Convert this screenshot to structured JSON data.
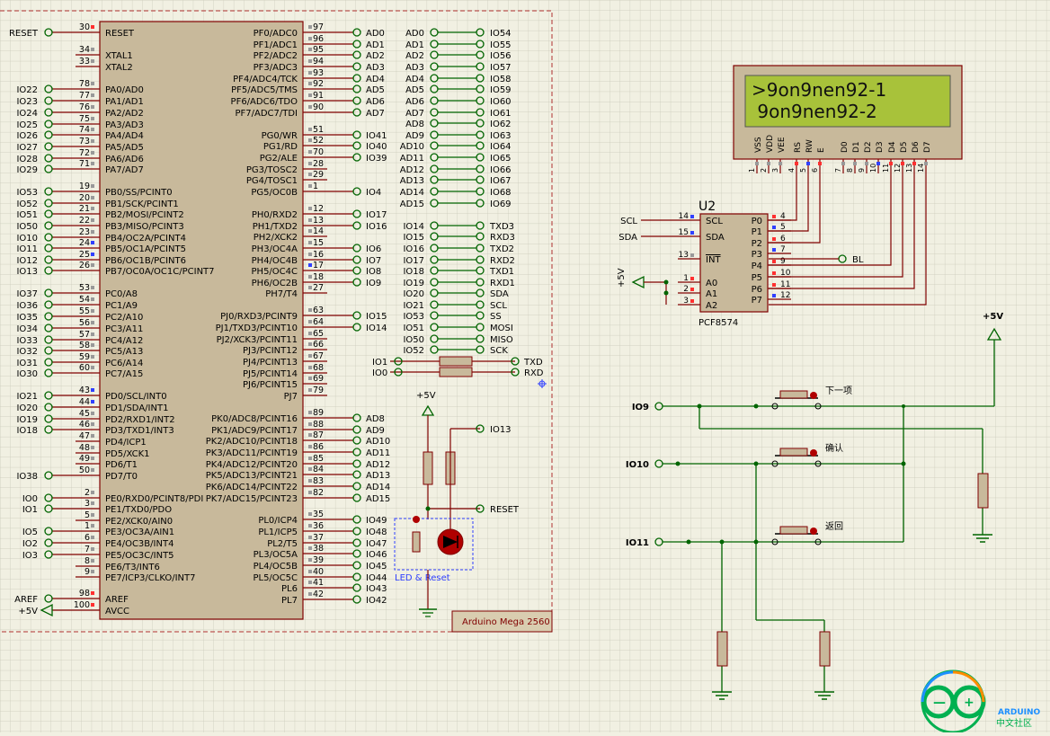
{
  "mega": {
    "title": "Arduino Mega 2560",
    "left": [
      {
        "pin": "30",
        "label": "RESET",
        "net": "RESET"
      },
      {
        "pin": "34",
        "label": "XTAL1",
        "net": ""
      },
      {
        "pin": "33",
        "label": "XTAL2",
        "net": ""
      },
      {
        "pin": "78",
        "label": "PA0/AD0",
        "net": "IO22"
      },
      {
        "pin": "77",
        "label": "PA1/AD1",
        "net": "IO23"
      },
      {
        "pin": "76",
        "label": "PA2/AD2",
        "net": "IO24"
      },
      {
        "pin": "75",
        "label": "PA3/AD3",
        "net": "IO25"
      },
      {
        "pin": "74",
        "label": "PA4/AD4",
        "net": "IO26"
      },
      {
        "pin": "73",
        "label": "PA5/AD5",
        "net": "IO27"
      },
      {
        "pin": "72",
        "label": "PA6/AD6",
        "net": "IO28"
      },
      {
        "pin": "71",
        "label": "PA7/AD7",
        "net": "IO29"
      },
      {
        "pin": "19",
        "label": "PB0/SS/PCINT0",
        "net": "IO53"
      },
      {
        "pin": "20",
        "label": "PB1/SCK/PCINT1",
        "net": "IO52"
      },
      {
        "pin": "21",
        "label": "PB2/MOSI/PCINT2",
        "net": "IO51"
      },
      {
        "pin": "22",
        "label": "PB3/MISO/PCINT3",
        "net": "IO50"
      },
      {
        "pin": "23",
        "label": "PB4/OC2A/PCINT4",
        "net": "IO10"
      },
      {
        "pin": "24",
        "label": "PB5/OC1A/PCINT5",
        "net": "IO11"
      },
      {
        "pin": "25",
        "label": "PB6/OC1B/PCINT6",
        "net": "IO12"
      },
      {
        "pin": "26",
        "label": "PB7/OC0A/OC1C/PCINT7",
        "net": "IO13"
      },
      {
        "pin": "53",
        "label": "PC0/A8",
        "net": "IO37"
      },
      {
        "pin": "54",
        "label": "PC1/A9",
        "net": "IO36"
      },
      {
        "pin": "55",
        "label": "PC2/A10",
        "net": "IO35"
      },
      {
        "pin": "56",
        "label": "PC3/A11",
        "net": "IO34"
      },
      {
        "pin": "57",
        "label": "PC4/A12",
        "net": "IO33"
      },
      {
        "pin": "58",
        "label": "PC5/A13",
        "net": "IO32"
      },
      {
        "pin": "59",
        "label": "PC6/A14",
        "net": "IO31"
      },
      {
        "pin": "60",
        "label": "PC7/A15",
        "net": "IO30"
      },
      {
        "pin": "43",
        "label": "PD0/SCL/INT0",
        "net": "IO21"
      },
      {
        "pin": "44",
        "label": "PD1/SDA/INT1",
        "net": "IO20"
      },
      {
        "pin": "45",
        "label": "PD2/RXD1/INT2",
        "net": "IO19"
      },
      {
        "pin": "46",
        "label": "PD3/TXD1/INT3",
        "net": "IO18"
      },
      {
        "pin": "47",
        "label": "PD4/ICP1",
        "net": ""
      },
      {
        "pin": "48",
        "label": "PD5/XCK1",
        "net": ""
      },
      {
        "pin": "49",
        "label": "PD6/T1",
        "net": ""
      },
      {
        "pin": "50",
        "label": "PD7/T0",
        "net": "IO38"
      },
      {
        "pin": "2",
        "label": "PE0/RXD0/PCINT8/PDI",
        "net": "IO0"
      },
      {
        "pin": "3",
        "label": "PE1/TXD0/PDO",
        "net": "IO1"
      },
      {
        "pin": "5",
        "label": "PE2/XCK0/AIN0",
        "net": ""
      },
      {
        "pin": "1",
        "label": "PE3/OC3A/AIN1",
        "net": "IO5"
      },
      {
        "pin": "6",
        "label": "PE4/OC3B/INT4",
        "net": "IO2"
      },
      {
        "pin": "7",
        "label": "PE5/OC3C/INT5",
        "net": "IO3"
      },
      {
        "pin": "8",
        "label": "PE6/T3/INT6",
        "net": ""
      },
      {
        "pin": "9",
        "label": "PE7/ICP3/CLKO/INT7",
        "net": ""
      },
      {
        "pin": "98",
        "label": "AREF",
        "net": "AREF"
      },
      {
        "pin": "100",
        "label": "AVCC",
        "net": "+5V"
      }
    ],
    "right": [
      {
        "pin": "97",
        "label": "PF0/ADC0",
        "net": "AD0"
      },
      {
        "pin": "96",
        "label": "PF1/ADC1",
        "net": "AD1"
      },
      {
        "pin": "95",
        "label": "PF2/ADC2",
        "net": "AD2"
      },
      {
        "pin": "94",
        "label": "PF3/ADC3",
        "net": "AD3"
      },
      {
        "pin": "93",
        "label": "PF4/ADC4/TCK",
        "net": "AD4"
      },
      {
        "pin": "92",
        "label": "PF5/ADC5/TMS",
        "net": "AD5"
      },
      {
        "pin": "91",
        "label": "PF6/ADC6/TDO",
        "net": "AD6"
      },
      {
        "pin": "90",
        "label": "PF7/ADC7/TDI",
        "net": "AD7"
      },
      {
        "pin": "51",
        "label": "PG0/WR",
        "net": "IO41"
      },
      {
        "pin": "52",
        "label": "PG1/RD",
        "net": "IO40"
      },
      {
        "pin": "70",
        "label": "PG2/ALE",
        "net": "IO39"
      },
      {
        "pin": "28",
        "label": "PG3/TOSC2",
        "net": ""
      },
      {
        "pin": "29",
        "label": "PG4/TOSC1",
        "net": ""
      },
      {
        "pin": "1",
        "label": "PG5/OC0B",
        "net": "IO4"
      },
      {
        "pin": "12",
        "label": "PH0/RXD2",
        "net": "IO17"
      },
      {
        "pin": "13",
        "label": "PH1/TXD2",
        "net": "IO16"
      },
      {
        "pin": "14",
        "label": "PH2/XCK2",
        "net": ""
      },
      {
        "pin": "15",
        "label": "PH3/OC4A",
        "net": "IO6"
      },
      {
        "pin": "16",
        "label": "PH4/OC4B",
        "net": "IO7"
      },
      {
        "pin": "17",
        "label": "PH5/OC4C",
        "net": "IO8"
      },
      {
        "pin": "18",
        "label": "PH6/OC2B",
        "net": "IO9"
      },
      {
        "pin": "27",
        "label": "PH7/T4",
        "net": ""
      },
      {
        "pin": "63",
        "label": "PJ0/RXD3/PCINT9",
        "net": "IO15"
      },
      {
        "pin": "64",
        "label": "PJ1/TXD3/PCINT10",
        "net": "IO14"
      },
      {
        "pin": "65",
        "label": "PJ2/XCK3/PCINT11",
        "net": ""
      },
      {
        "pin": "66",
        "label": "PJ3/PCINT12",
        "net": ""
      },
      {
        "pin": "67",
        "label": "PJ4/PCINT13",
        "net": ""
      },
      {
        "pin": "68",
        "label": "PJ5/PCINT14",
        "net": ""
      },
      {
        "pin": "69",
        "label": "PJ6/PCINT15",
        "net": ""
      },
      {
        "pin": "79",
        "label": "PJ7",
        "net": ""
      },
      {
        "pin": "89",
        "label": "PK0/ADC8/PCINT16",
        "net": "AD8"
      },
      {
        "pin": "88",
        "label": "PK1/ADC9/PCINT17",
        "net": "AD9"
      },
      {
        "pin": "87",
        "label": "PK2/ADC10/PCINT18",
        "net": "AD10"
      },
      {
        "pin": "86",
        "label": "PK3/ADC11/PCINT19",
        "net": "AD11"
      },
      {
        "pin": "85",
        "label": "PK4/ADC12/PCINT20",
        "net": "AD12"
      },
      {
        "pin": "84",
        "label": "PK5/ADC13/PCINT21",
        "net": "AD13"
      },
      {
        "pin": "83",
        "label": "PK6/ADC14/PCINT22",
        "net": "AD14"
      },
      {
        "pin": "82",
        "label": "PK7/ADC15/PCINT23",
        "net": "AD15"
      },
      {
        "pin": "35",
        "label": "PL0/ICP4",
        "net": "IO49"
      },
      {
        "pin": "36",
        "label": "PL1/ICP5",
        "net": "IO48"
      },
      {
        "pin": "37",
        "label": "PL2/T5",
        "net": "IO47"
      },
      {
        "pin": "38",
        "label": "PL3/OC5A",
        "net": "IO46"
      },
      {
        "pin": "39",
        "label": "PL4/OC5B",
        "net": "IO45"
      },
      {
        "pin": "40",
        "label": "PL5/OC5C",
        "net": "IO44"
      },
      {
        "pin": "41",
        "label": "PL6",
        "net": "IO43"
      },
      {
        "pin": "42",
        "label": "PL7",
        "net": "IO42"
      }
    ]
  },
  "header_map": [
    {
      "a": "AD0",
      "b": "IO54"
    },
    {
      "a": "AD1",
      "b": "IO55"
    },
    {
      "a": "AD2",
      "b": "IO56"
    },
    {
      "a": "AD3",
      "b": "IO57"
    },
    {
      "a": "AD4",
      "b": "IO58"
    },
    {
      "a": "AD5",
      "b": "IO59"
    },
    {
      "a": "AD6",
      "b": "IO60"
    },
    {
      "a": "AD7",
      "b": "IO61"
    },
    {
      "a": "AD8",
      "b": "IO62"
    },
    {
      "a": "AD9",
      "b": "IO63"
    },
    {
      "a": "AD10",
      "b": "IO64"
    },
    {
      "a": "AD11",
      "b": "IO65"
    },
    {
      "a": "AD12",
      "b": "IO66"
    },
    {
      "a": "AD13",
      "b": "IO67"
    },
    {
      "a": "AD14",
      "b": "IO68"
    },
    {
      "a": "AD15",
      "b": "IO69"
    },
    {
      "a": "IO14",
      "b": "TXD3"
    },
    {
      "a": "IO15",
      "b": "RXD3"
    },
    {
      "a": "IO16",
      "b": "TXD2"
    },
    {
      "a": "IO17",
      "b": "RXD2"
    },
    {
      "a": "IO18",
      "b": "TXD1"
    },
    {
      "a": "IO19",
      "b": "RXD1"
    },
    {
      "a": "IO20",
      "b": "SDA"
    },
    {
      "a": "IO21",
      "b": "SCL"
    },
    {
      "a": "IO53",
      "b": "SS"
    },
    {
      "a": "IO51",
      "b": "MOSI"
    },
    {
      "a": "IO50",
      "b": "MISO"
    },
    {
      "a": "IO52",
      "b": "SCK"
    }
  ],
  "serial": {
    "io1": "IO1",
    "io0": "IO0",
    "txd": "TXD",
    "rxd": "RXD"
  },
  "reset_circuit": {
    "plus5v": "+5V",
    "io13": "IO13",
    "reset": "RESET",
    "caption": "LED & Reset"
  },
  "lcd": {
    "line1": ">9on9nen92-1",
    "line2": " 9on9nen92-2",
    "pins": [
      "VSS",
      "VDD",
      "VEE",
      "RS",
      "RW",
      "E",
      "D0",
      "D1",
      "D2",
      "D3",
      "D4",
      "D5",
      "D6",
      "D7"
    ],
    "pin_numbers": [
      "1",
      "2",
      "3",
      "4",
      "5",
      "6",
      "7",
      "8",
      "9",
      "10",
      "11",
      "12",
      "13",
      "14"
    ]
  },
  "pcf": {
    "ref": "U2",
    "part": "PCF8574",
    "left_pins": [
      {
        "num": "14",
        "label": "SCL",
        "net": "SCL"
      },
      {
        "num": "15",
        "label": "SDA",
        "net": "SDA"
      },
      {
        "num": "13",
        "label": "INT",
        "net": ""
      },
      {
        "num": "1",
        "label": "A0",
        "net": ""
      },
      {
        "num": "2",
        "label": "A1",
        "net": ""
      },
      {
        "num": "3",
        "label": "A2",
        "net": ""
      }
    ],
    "right_pins": [
      {
        "num": "4",
        "label": "P0"
      },
      {
        "num": "5",
        "label": "P1"
      },
      {
        "num": "6",
        "label": "P2"
      },
      {
        "num": "7",
        "label": "P3"
      },
      {
        "num": "9",
        "label": "P4"
      },
      {
        "num": "10",
        "label": "P5"
      },
      {
        "num": "11",
        "label": "P6"
      },
      {
        "num": "12",
        "label": "P7"
      }
    ],
    "supply": "+5V",
    "bl": "BL"
  },
  "buttons": {
    "supply": "+5V",
    "items": [
      {
        "net": "IO9",
        "label": "下一项"
      },
      {
        "net": "IO10",
        "label": "确认"
      },
      {
        "net": "IO11",
        "label": "返回"
      }
    ]
  },
  "logo": {
    "line1": "ARDUINO",
    "line2": "中文社区"
  },
  "colors": {
    "background": "#f1f0e2",
    "wire": "#800000",
    "junction": "#006400",
    "pin_red": "#ff3030",
    "pin_blue": "#3040ff",
    "lcd_screen": "#a8c23a",
    "component_body": "#c8b99b",
    "accent_green": "#00b050"
  }
}
